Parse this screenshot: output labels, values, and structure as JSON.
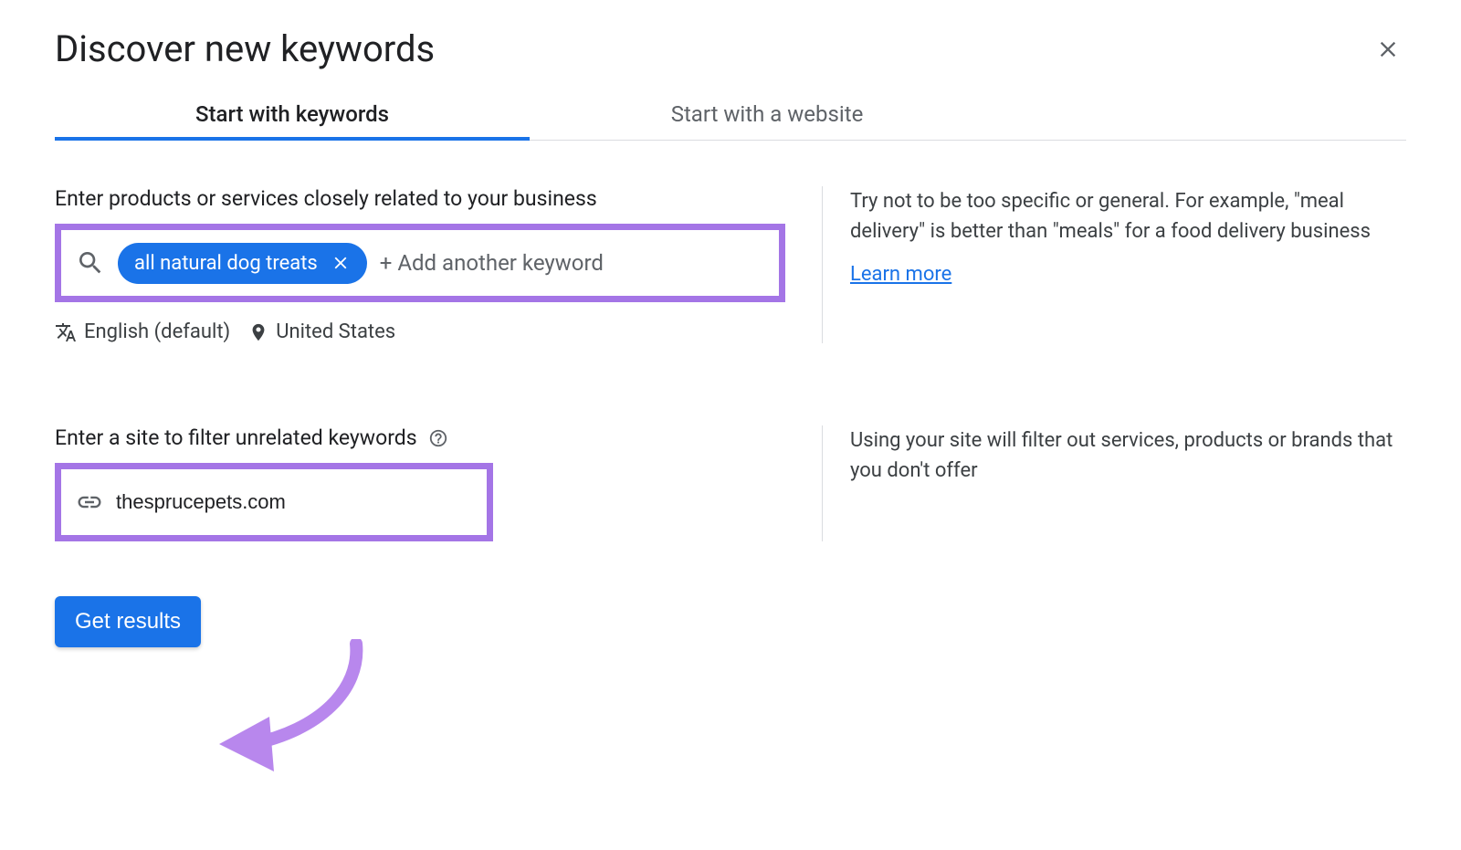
{
  "header": {
    "title": "Discover new keywords"
  },
  "tabs": {
    "keywords": "Start with keywords",
    "website": "Start with a website"
  },
  "keywords_section": {
    "label": "Enter products or services closely related to your business",
    "chip": "all natural dog treats",
    "add_placeholder": "+ Add another keyword",
    "language": "English (default)",
    "location": "United States",
    "hint": "Try not to be too specific or general. For example, \"meal delivery\" is better than \"meals\" for a food delivery business",
    "learn_more": "Learn more"
  },
  "site_section": {
    "label": "Enter a site to filter unrelated keywords",
    "value": "thesprucepets.com",
    "hint": "Using your site will filter out services, products or brands that you don't offer"
  },
  "actions": {
    "get_results": "Get results"
  }
}
